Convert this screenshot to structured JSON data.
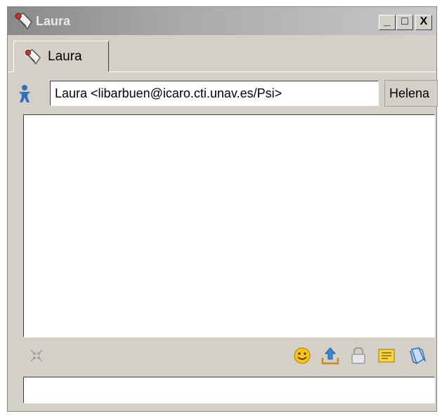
{
  "window": {
    "title": "Laura",
    "app_icon": "shuttlecock-icon",
    "controls": {
      "minimize": "_",
      "maximize": "□",
      "close": "X"
    }
  },
  "tabs": [
    {
      "label": "Laura",
      "icon": "shuttlecock-icon",
      "active": true
    }
  ],
  "contact": {
    "icon": "person-icon",
    "address": "Laura <libarbuen@icaro.cti.unav.es/Psi>",
    "self_button_label": "Helena"
  },
  "chat_log": {
    "messages": []
  },
  "toolbar": {
    "left_icon": "collapse-arrows-icon",
    "right_icons": [
      "smiley-icon",
      "send-file-icon",
      "lock-icon",
      "notes-icon",
      "attach-icon"
    ]
  },
  "message_input": {
    "value": ""
  }
}
